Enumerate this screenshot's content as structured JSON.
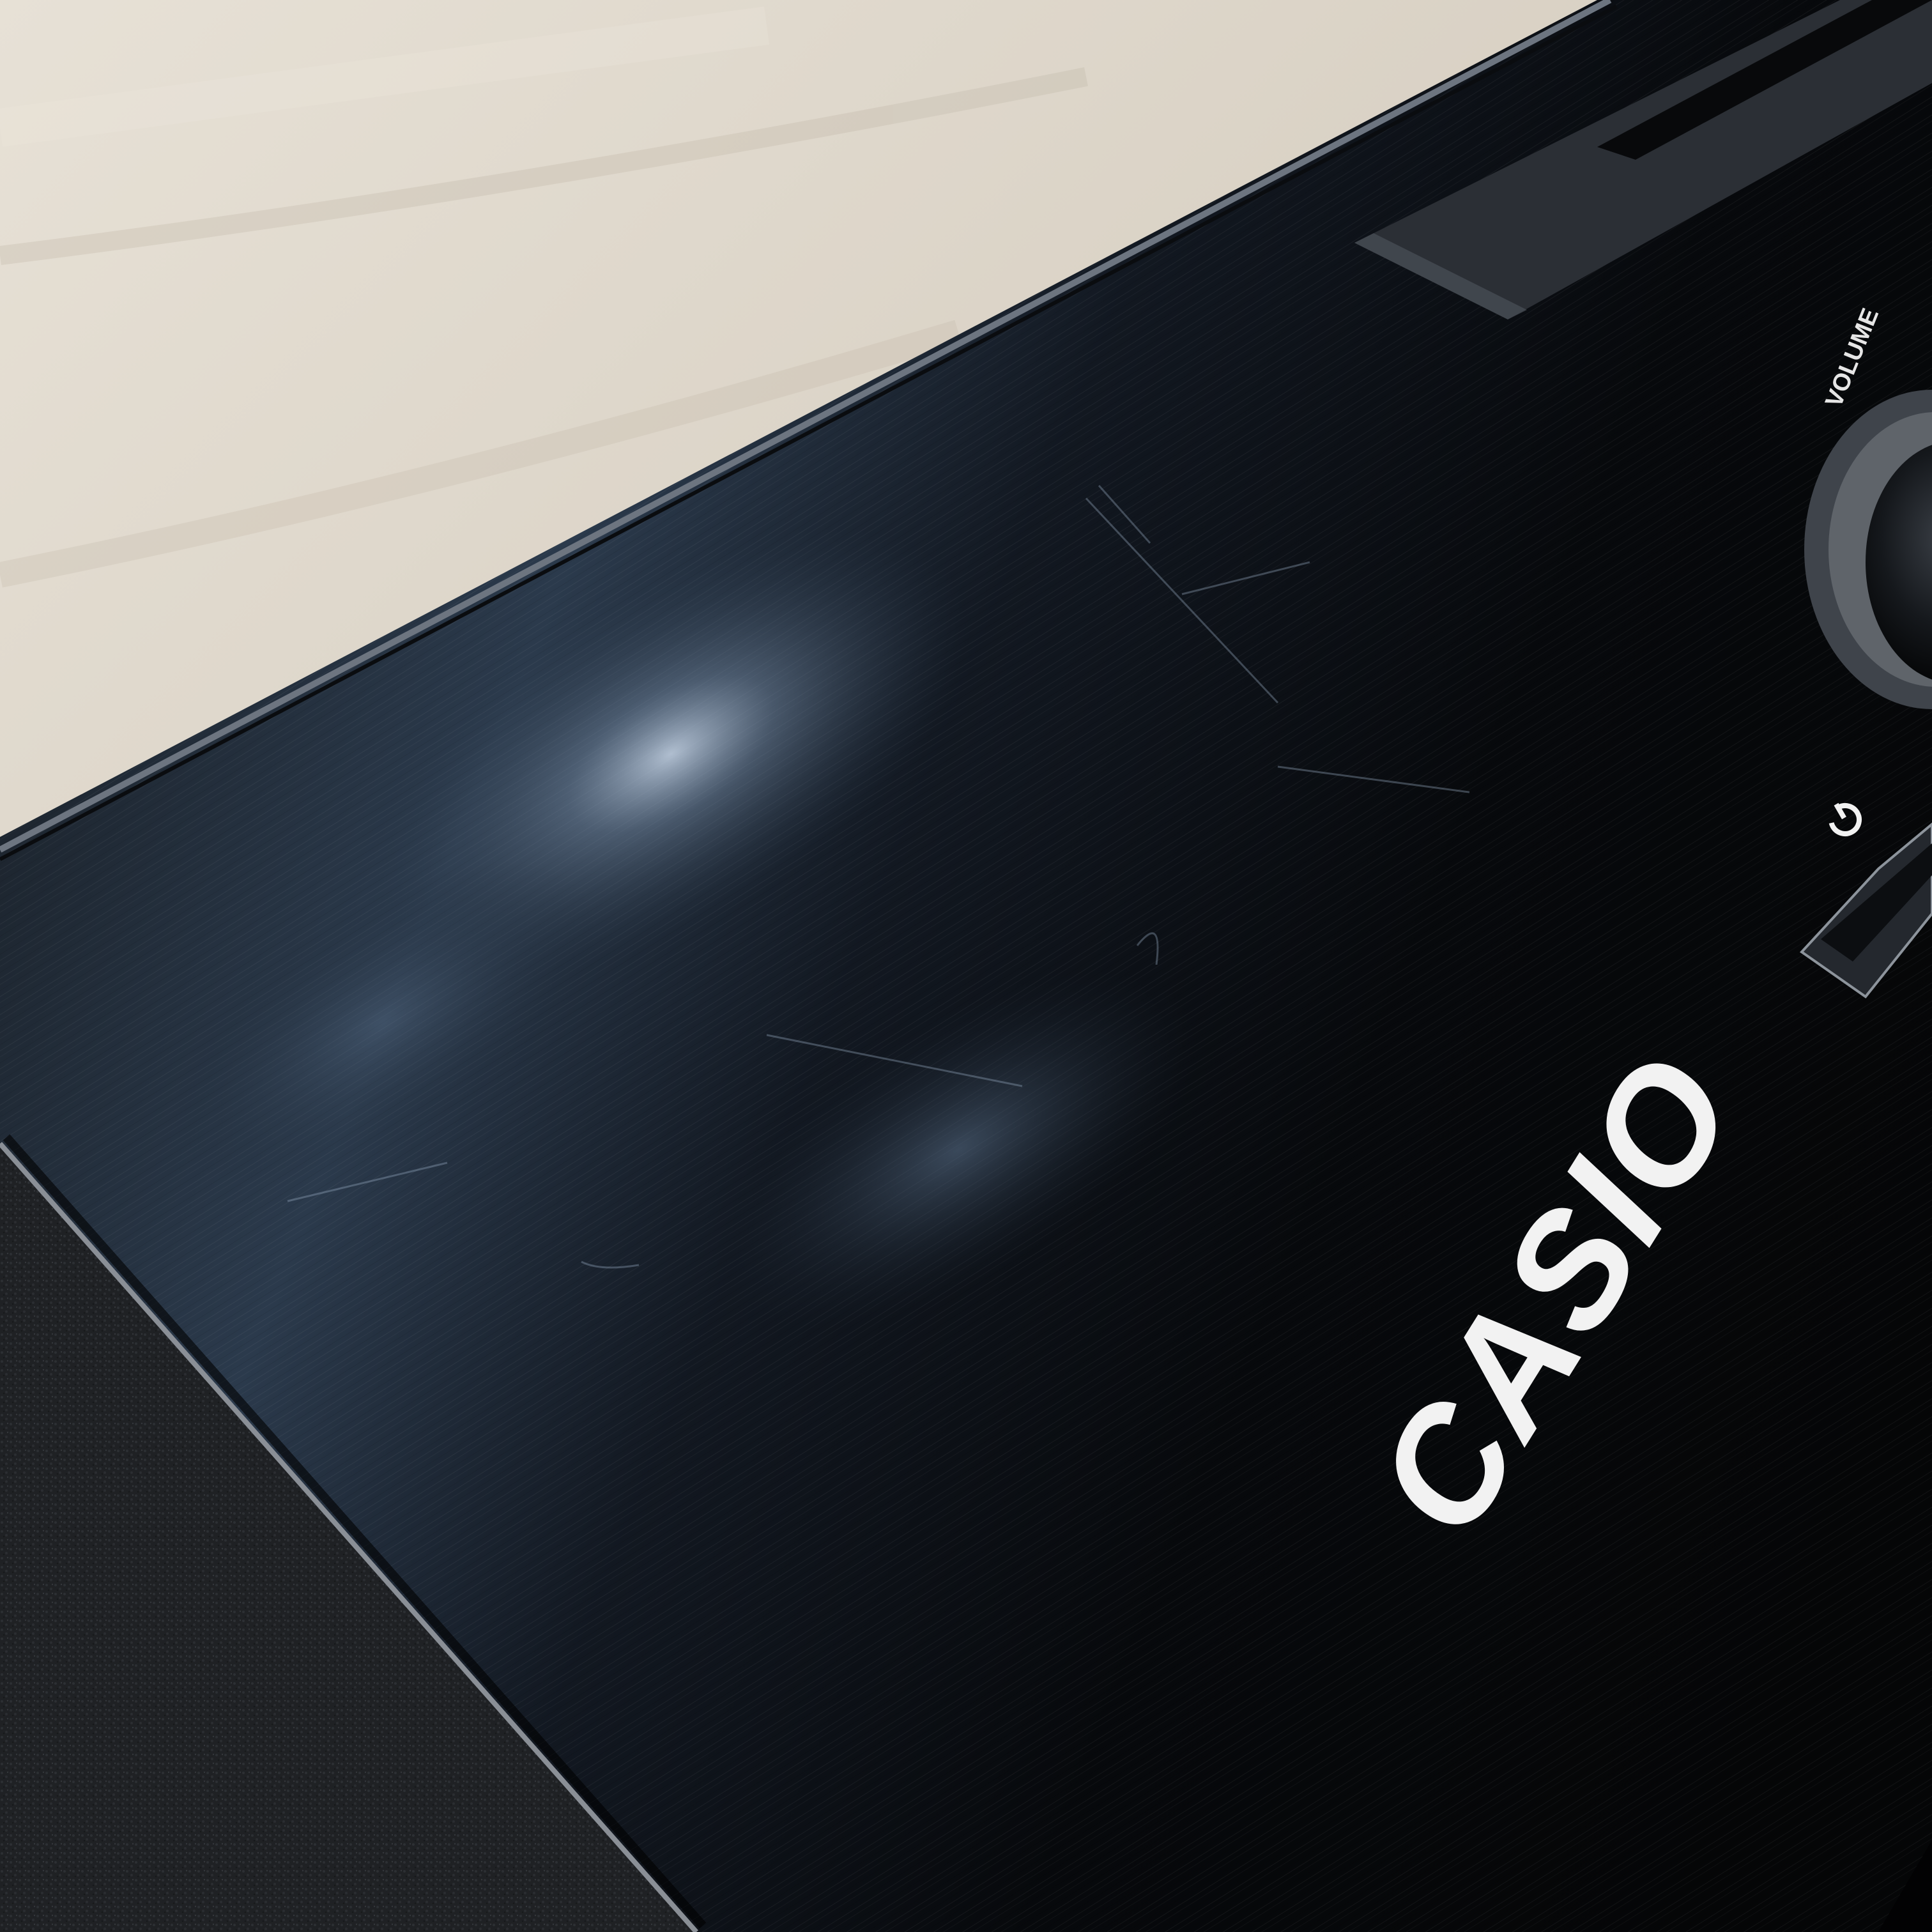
{
  "brand": {
    "logo_text": "CASIO"
  },
  "controls": {
    "volume_label": "VOLUME",
    "power_icon": "power-icon",
    "volume_knob_icon": "knob-icon"
  },
  "colors": {
    "floor": "#d9d2c6",
    "panel": "#0b0d10",
    "panel_highlight": "#4a5f78",
    "speaker_grille": "#1d1f22",
    "logo": "#f2f2f2"
  }
}
